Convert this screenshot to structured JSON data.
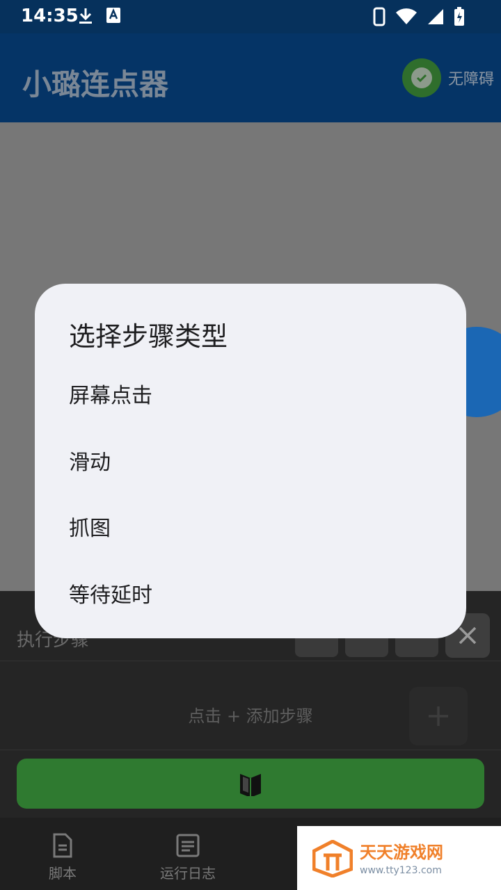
{
  "status_bar": {
    "time": "14:35",
    "left_icons": [
      "download-icon",
      "keyboard-icon"
    ],
    "right_icons": [
      "phone-icon",
      "wifi-icon",
      "signal-icon",
      "battery-charging-icon"
    ]
  },
  "app_bar": {
    "title": "小璐连点器",
    "accessibility_label": "无障碍"
  },
  "panel": {
    "title": "执行步骤",
    "empty_hint": "点击 + 添加步骤",
    "add_symbol": "+"
  },
  "bottom_nav": [
    {
      "label": "脚本",
      "icon": "script-icon"
    },
    {
      "label": "运行日志",
      "icon": "log-icon"
    }
  ],
  "dialog": {
    "title": "选择步骤类型",
    "options": [
      "屏幕点击",
      "滑动",
      "抓图",
      "等待延时"
    ]
  },
  "watermark": {
    "brand": "天天游戏网",
    "url": "www.tty123.com"
  },
  "colors": {
    "accent_green": "#2f7a30",
    "app_bar": "#053466",
    "dialog_bg": "#f0f1f6"
  }
}
